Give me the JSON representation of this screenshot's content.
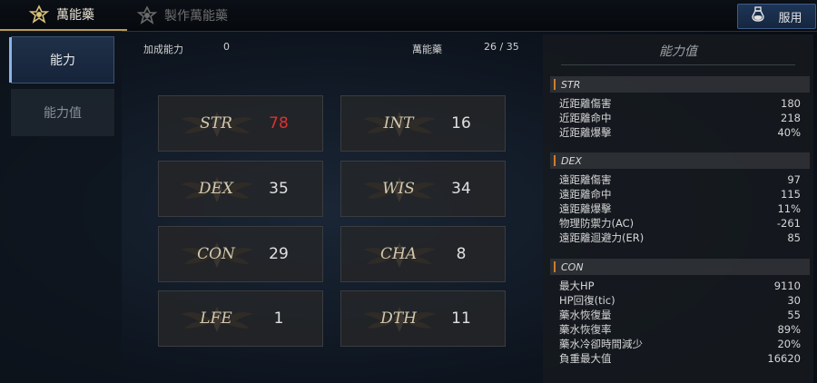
{
  "tabs": {
    "active": "萬能藥",
    "inactive": "製作萬能藥"
  },
  "use_button": "服用",
  "sidebar": {
    "items": [
      {
        "label": "能力"
      },
      {
        "label": "能力值"
      }
    ]
  },
  "summary": {
    "bonus_label": "加成能力",
    "bonus_value": "0",
    "elixir_label": "萬能藥",
    "elixir_value": "26 / 35"
  },
  "stats": [
    {
      "name": "STR",
      "value": "78",
      "highlight": true
    },
    {
      "name": "INT",
      "value": "16"
    },
    {
      "name": "DEX",
      "value": "35"
    },
    {
      "name": "WIS",
      "value": "34"
    },
    {
      "name": "CON",
      "value": "29"
    },
    {
      "name": "CHA",
      "value": "8"
    },
    {
      "name": "LFE",
      "value": "1"
    },
    {
      "name": "DTH",
      "value": "11"
    }
  ],
  "panel": {
    "title": "能力值",
    "sections": [
      {
        "name": "STR",
        "rows": [
          [
            "近距離傷害",
            "180"
          ],
          [
            "近距離命中",
            "218"
          ],
          [
            "近距離爆擊",
            "40%"
          ]
        ]
      },
      {
        "name": "DEX",
        "rows": [
          [
            "遠距離傷害",
            "97"
          ],
          [
            "遠距離命中",
            "115"
          ],
          [
            "遠距離爆擊",
            "11%"
          ],
          [
            "物理防禦力(AC)",
            "-261"
          ],
          [
            "遠距離迴避力(ER)",
            "85"
          ]
        ]
      },
      {
        "name": "CON",
        "rows": [
          [
            "最大HP",
            "9110"
          ],
          [
            "HP回復(tic)",
            "30"
          ],
          [
            "藥水恢復量",
            "55"
          ],
          [
            "藥水恢復率",
            "89%"
          ],
          [
            "藥水冷卻時間減少",
            "20%"
          ],
          [
            "負重最大值",
            "16620"
          ]
        ]
      }
    ]
  },
  "colors": {
    "accent": "#d27a2a",
    "highlight": "#e03030"
  }
}
